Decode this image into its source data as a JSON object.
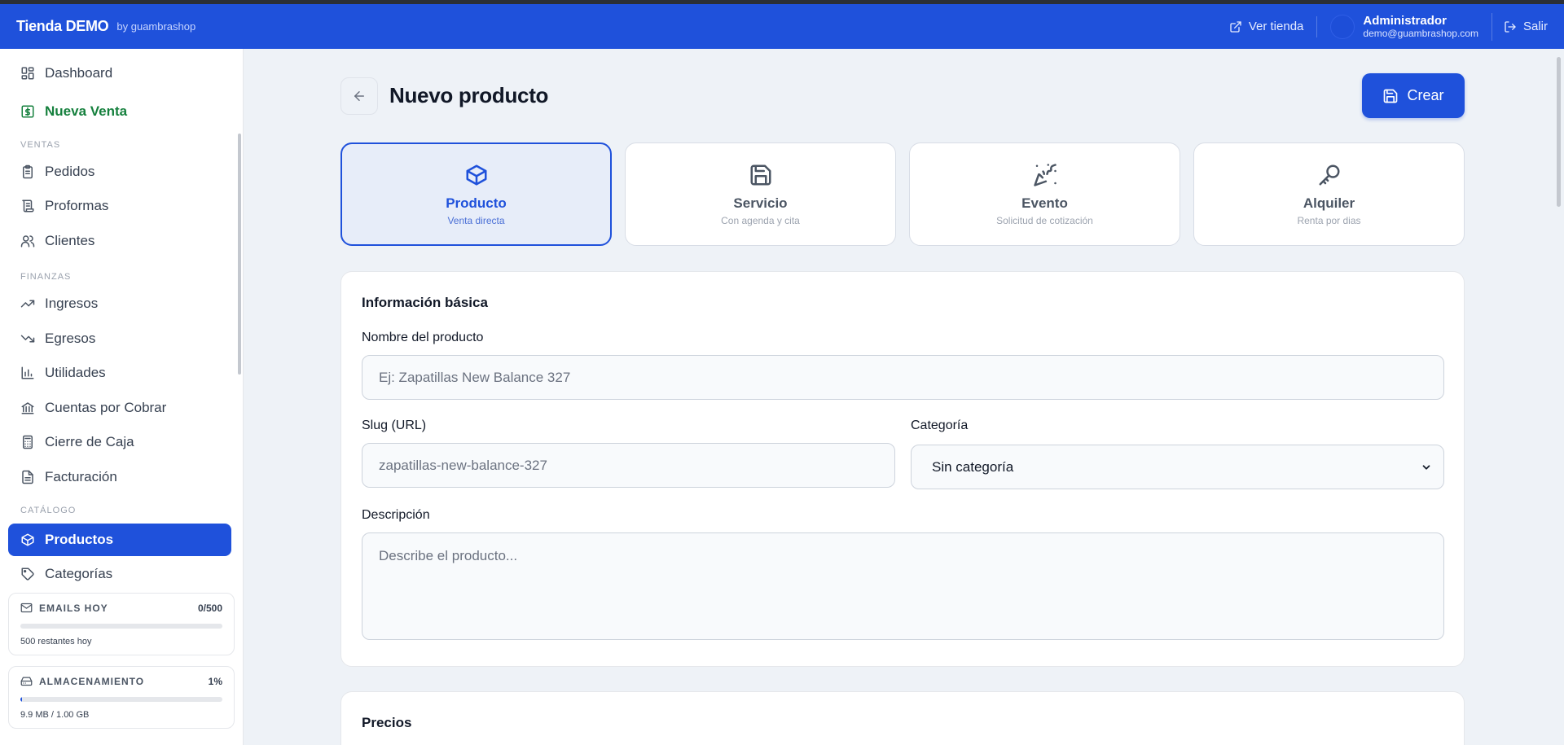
{
  "topbar": {
    "brand": "Tienda DEMO",
    "brand_sub": "by guambrashop",
    "view_store": "Ver tienda",
    "user_name": "Administrador",
    "user_email": "demo@guambrashop.com",
    "logout": "Salir",
    "bg_color": "#1f51db"
  },
  "sidebar": {
    "dashboard": "Dashboard",
    "new_sale": "Nueva Venta",
    "sections": {
      "ventas": "VENTAS",
      "finanzas": "FINANZAS",
      "catalogo": "CATÁLOGO"
    },
    "items": {
      "pedidos": "Pedidos",
      "proformas": "Proformas",
      "clientes": "Clientes",
      "ingresos": "Ingresos",
      "egresos": "Egresos",
      "utilidades": "Utilidades",
      "cuentas": "Cuentas por Cobrar",
      "cierre": "Cierre de Caja",
      "facturacion": "Facturación",
      "productos": "Productos",
      "categorias": "Categorías"
    },
    "emails": {
      "label": "EMAILS HOY",
      "value": "0/500",
      "used_fraction": 0,
      "foot": "500 restantes hoy"
    },
    "storage": {
      "label": "ALMACENAMIENTO",
      "value": "1%",
      "used_fraction": 0.01,
      "foot": "9.9 MB / 1.00 GB"
    }
  },
  "page": {
    "title": "Nuevo producto",
    "create_label": "Crear"
  },
  "types": [
    {
      "title": "Producto",
      "sub": "Venta directa",
      "icon": "box-icon",
      "selected": true
    },
    {
      "title": "Servicio",
      "sub": "Con agenda y cita",
      "icon": "save-icon",
      "selected": false
    },
    {
      "title": "Evento",
      "sub": "Solicitud de cotización",
      "icon": "party-popper-icon",
      "selected": false
    },
    {
      "title": "Alquiler",
      "sub": "Renta por dias",
      "icon": "key-icon",
      "selected": false
    }
  ],
  "basic_info": {
    "title": "Información básica",
    "name_label": "Nombre del producto",
    "name_placeholder": "Ej: Zapatillas New Balance 327",
    "slug_label": "Slug (URL)",
    "slug_placeholder": "zapatillas-new-balance-327",
    "category_label": "Categoría",
    "category_value": "Sin categoría",
    "description_label": "Descripción",
    "description_placeholder": "Describe el producto..."
  },
  "prices": {
    "title": "Precios"
  }
}
